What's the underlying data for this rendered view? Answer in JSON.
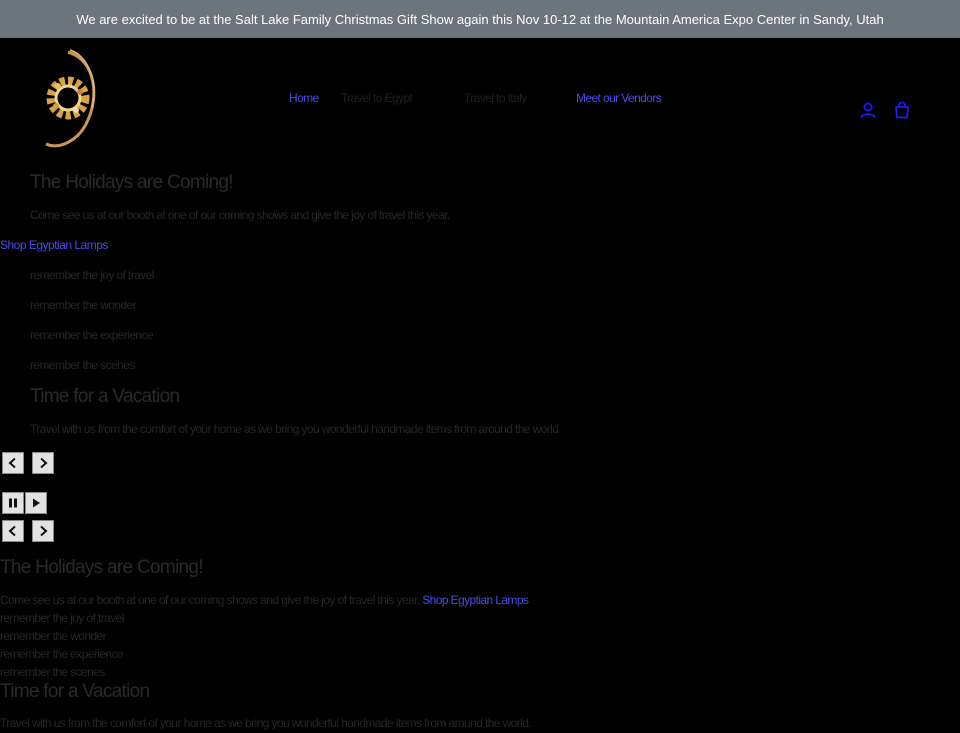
{
  "announcement": "We are excited to be at the Salt Lake Family Christmas Gift Show again this Nov 10-12 at the Mountain America Expo Center in Sandy, Utah",
  "nav": {
    "home": "Home",
    "egypt": "Travel to Egypt",
    "italy": "Travel to Italy",
    "vendors": "Meet our Vendors"
  },
  "header_icons": {
    "account": "account-icon",
    "cart": "cart-icon"
  },
  "colors": {
    "announcement_bg": "#6c757d",
    "page_bg": "#000000",
    "link": "#4b4be8"
  },
  "slide_a": {
    "heading": "The Holidays are Coming!",
    "intro": "Come see us at our booth at one of our coming shows and give the joy of travel this year.",
    "cta": "Shop Egyptian Lamps",
    "lines": [
      "remember the joy of travel",
      "remember the wonder",
      "remember the experience",
      "remember the scenes"
    ],
    "heading2": "Time for a Vacation",
    "body2": "Travel with us from the comfort of your home as we bring you wonderful handmade items from around the world."
  },
  "controls": {
    "prev": "chevron-left-icon",
    "next": "chevron-right-icon",
    "pause": "pause-icon",
    "play": "play-icon"
  },
  "slide_b": {
    "heading": "The Holidays are Coming!",
    "intro": "Come see us at our booth at one of our coming shows and give the joy of travel this year.",
    "cta": "Shop Egyptian Lamps",
    "lines": [
      "remember the joy of travel",
      "remember the wonder",
      "remember the experience",
      "remember the scenes"
    ],
    "heading2": "Time for a Vacation",
    "body2": "Travel with us from the comfort of your home as we bring you wonderful handmade items from around the world."
  }
}
